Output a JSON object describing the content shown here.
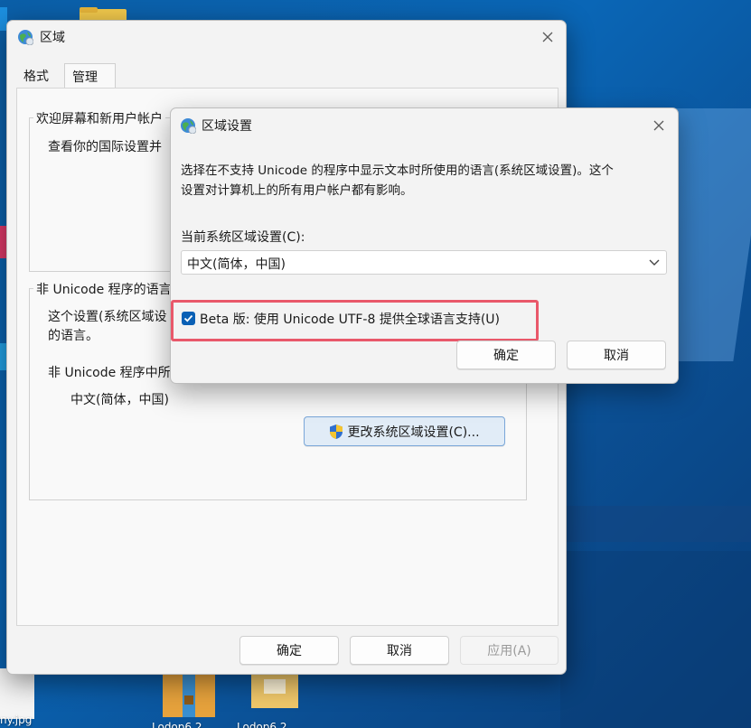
{
  "colors": {
    "desktop_bg": "#0b5fa8",
    "window_bg": "#f3f3f3",
    "accent": "#0a60b5",
    "highlight_box": "#e9586a"
  },
  "desktop": {
    "icons": [
      {
        "name": "folder-icon",
        "label": ""
      },
      {
        "name": "zip-archive-icon",
        "label": "Lodop6.2..."
      },
      {
        "name": "zip-archive-icon-2",
        "label": "Lodop6.2..."
      }
    ],
    "left_edge_label": "ny.jpg"
  },
  "main_window": {
    "title": "区域",
    "title_icon": "globe-icon",
    "tabs": [
      {
        "label": "格式",
        "active": false
      },
      {
        "label": "管理",
        "active": true
      }
    ],
    "welcome_group": {
      "title": "欢迎屏幕和新用户帐户",
      "text": "查看你的国际设置并"
    },
    "non_unicode_group": {
      "title": "非 Unicode 程序的语言",
      "text_line1": "这个设置(系统区域设",
      "text_line2": "的语言。",
      "current_label": "非 Unicode 程序中所",
      "current_value": "中文(简体，中国)",
      "change_button": "更改系统区域设置(C)..."
    },
    "buttons": {
      "ok": "确定",
      "cancel": "取消",
      "apply": "应用(A)"
    }
  },
  "dialog": {
    "title": "区域设置",
    "title_icon": "globe-icon",
    "description_line1": "选择在不支持 Unicode 的程序中显示文本时所使用的语言(系统区域设置)。这个",
    "description_line2": "设置对计算机上的所有用户帐户都有影响。",
    "current_locale_label": "当前系统区域设置(C):",
    "current_locale_value": "中文(简体，中国)",
    "beta_checkbox": {
      "label": "Beta 版: 使用 Unicode UTF-8 提供全球语言支持(U)",
      "checked": true
    },
    "buttons": {
      "ok": "确定",
      "cancel": "取消"
    }
  }
}
